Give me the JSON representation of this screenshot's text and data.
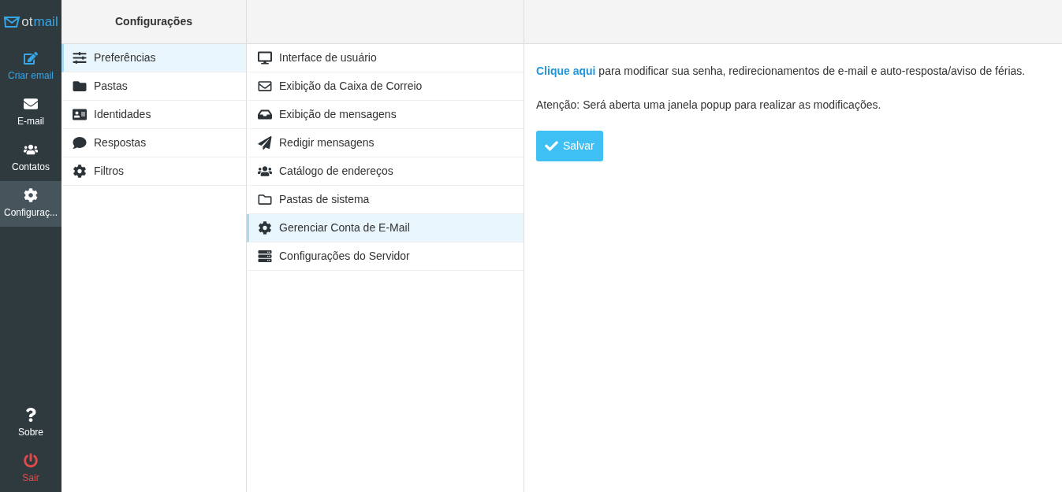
{
  "logo": {
    "text_a": "ot",
    "text_b": "mail"
  },
  "nav": [
    {
      "kind": "compose",
      "label": "Criar email",
      "selected": false
    },
    {
      "kind": "mail",
      "label": "E-mail",
      "selected": false
    },
    {
      "kind": "contacts",
      "label": "Contatos",
      "selected": false
    },
    {
      "kind": "settings",
      "label": "Configuraç...",
      "selected": true
    }
  ],
  "nav_bottom": [
    {
      "kind": "about",
      "label": "Sobre",
      "selected": false
    },
    {
      "kind": "logout",
      "label": "Sair",
      "selected": false
    }
  ],
  "sections": {
    "title": "Configurações",
    "items": [
      {
        "kind": "sliders",
        "label": "Preferências",
        "selected": true
      },
      {
        "kind": "folder",
        "label": "Pastas",
        "selected": false
      },
      {
        "kind": "idcard",
        "label": "Identidades",
        "selected": false
      },
      {
        "kind": "comment",
        "label": "Respostas",
        "selected": false
      },
      {
        "kind": "gear",
        "label": "Filtros",
        "selected": false
      }
    ]
  },
  "preferences": [
    {
      "kind": "desktop",
      "label": "Interface de usuário",
      "selected": false
    },
    {
      "kind": "envelope",
      "label": "Exibição da Caixa de Correio",
      "selected": false
    },
    {
      "kind": "inbox",
      "label": "Exibição de mensagens",
      "selected": false
    },
    {
      "kind": "plane",
      "label": "Redigir mensagens",
      "selected": false
    },
    {
      "kind": "users",
      "label": "Catálogo de endereços",
      "selected": false
    },
    {
      "kind": "folder_open",
      "label": "Pastas de sistema",
      "selected": false
    },
    {
      "kind": "gear",
      "label": "Gerenciar Conta de E-Mail",
      "selected": true
    },
    {
      "kind": "server",
      "label": "Configurações do Servidor",
      "selected": false
    }
  ],
  "content": {
    "link": "Clique aqui",
    "text": "para modificar sua senha, redirecionamentos de e-mail e auto-resposta/aviso de férias.",
    "notice": "Atenção: Será aberta uma janela popup para realizar as modificações.",
    "save_button": "Salvar"
  }
}
